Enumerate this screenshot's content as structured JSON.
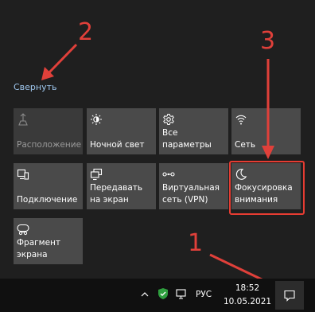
{
  "panel": {
    "collapse_label": "Свернуть"
  },
  "tiles": [
    {
      "label": "Расположение",
      "icon": "location-icon",
      "disabled": true
    },
    {
      "label": "Ночной свет",
      "icon": "brightness-icon",
      "disabled": false
    },
    {
      "label": "Все параметры",
      "icon": "gear-icon",
      "disabled": false
    },
    {
      "label": "Сеть",
      "icon": "network-icon",
      "disabled": false
    },
    {
      "label": "Подключение",
      "icon": "connect-icon",
      "disabled": false
    },
    {
      "label": "Передавать на экран",
      "icon": "project-icon",
      "disabled": false
    },
    {
      "label": "Виртуальная сеть (VPN)",
      "icon": "vpn-icon",
      "disabled": false
    },
    {
      "label": "Фокусировка внимания",
      "icon": "moon-icon",
      "disabled": false
    },
    {
      "label": "Фрагмент экрана",
      "icon": "snip-icon",
      "disabled": false
    }
  ],
  "annotations": {
    "numbers": [
      "1",
      "2",
      "3"
    ],
    "color": "#e0403a"
  },
  "taskbar": {
    "language": "РУС",
    "time": "18:52",
    "date": "10.05.2021"
  },
  "colors": {
    "background": "#1f1f1f",
    "tile": "#4a4a4a",
    "link": "#9fc7ee",
    "accent": "#e63c32"
  }
}
